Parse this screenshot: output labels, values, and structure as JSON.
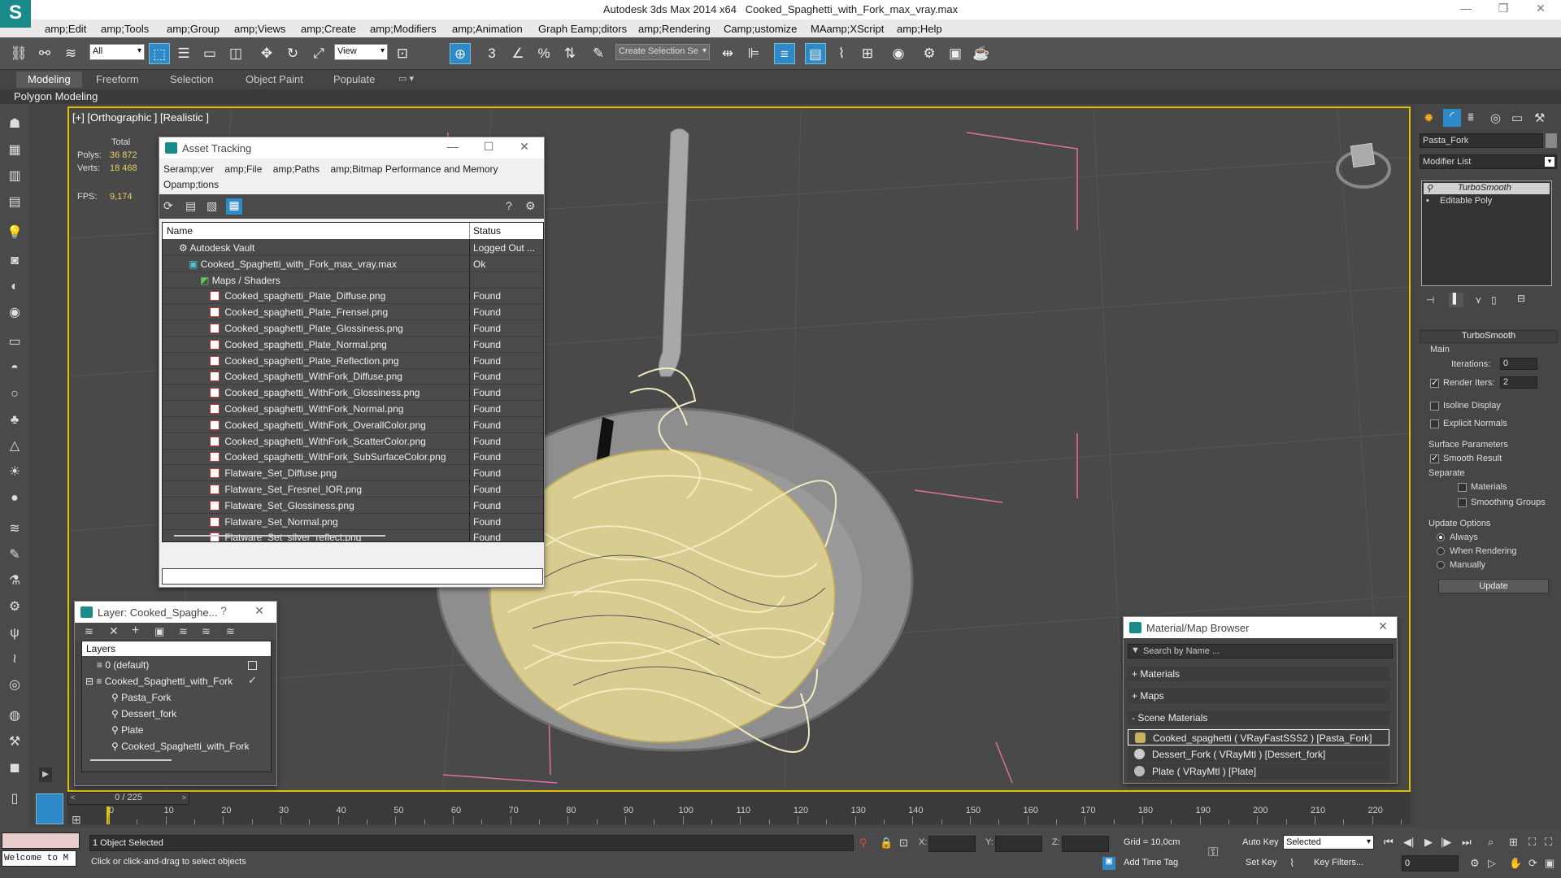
{
  "window": {
    "app_title": "Autodesk 3ds Max  2014 x64",
    "file_title": "Cooked_Spaghetti_with_Fork_max_vray.max"
  },
  "menu": [
    "amp;Edit",
    "amp;Tools",
    "amp;Group",
    "amp;Views",
    "amp;Create",
    "amp;Modifiers",
    "amp;Animation",
    "Graph Eamp;ditors",
    "amp;Rendering",
    "Camp;ustomize",
    "MAamp;XScript",
    "amp;Help"
  ],
  "toolbar": {
    "filter": "All",
    "coord": "View",
    "selection_set": "Create Selection Se",
    "snap_label": "3"
  },
  "ribbon": {
    "tabs": [
      "Modeling",
      "Freeform",
      "Selection",
      "Object Paint",
      "Populate"
    ],
    "sub": "Polygon Modeling"
  },
  "viewport": {
    "label": "[+] [Orthographic ] [Realistic ]",
    "stats": {
      "total_label": "Total",
      "polys_label": "Polys:",
      "polys": "36 872",
      "verts_label": "Verts:",
      "verts": "18 468",
      "fps_label": "FPS:",
      "fps": "9,174"
    }
  },
  "asset_tracking": {
    "title": "Asset Tracking",
    "menu": [
      "Seramp;ver",
      "amp;File",
      "amp;Paths",
      "amp;Bitmap Performance and Memory",
      "Opamp;tions"
    ],
    "col_name": "Name",
    "col_status": "Status",
    "rows": [
      {
        "name": "Autodesk Vault",
        "status": "Logged Out ..."
      },
      {
        "name": "Cooked_Spaghetti_with_Fork_max_vray.max",
        "status": "Ok"
      },
      {
        "name": "Maps / Shaders",
        "status": ""
      },
      {
        "name": "Cooked_spaghetti_Plate_Diffuse.png",
        "status": "Found"
      },
      {
        "name": "Cooked_spaghetti_Plate_Frensel.png",
        "status": "Found"
      },
      {
        "name": "Cooked_spaghetti_Plate_Glossiness.png",
        "status": "Found"
      },
      {
        "name": "Cooked_spaghetti_Plate_Normal.png",
        "status": "Found"
      },
      {
        "name": "Cooked_spaghetti_Plate_Reflection.png",
        "status": "Found"
      },
      {
        "name": "Cooked_spaghetti_WithFork_Diffuse.png",
        "status": "Found"
      },
      {
        "name": "Cooked_spaghetti_WithFork_Glossiness.png",
        "status": "Found"
      },
      {
        "name": "Cooked_spaghetti_WithFork_Normal.png",
        "status": "Found"
      },
      {
        "name": "Cooked_spaghetti_WithFork_OverallColor.png",
        "status": "Found"
      },
      {
        "name": "Cooked_spaghetti_WithFork_ScatterColor.png",
        "status": "Found"
      },
      {
        "name": "Cooked_spaghetti_WithFork_SubSurfaceColor.png",
        "status": "Found"
      },
      {
        "name": "Flatware_Set_Diffuse.png",
        "status": "Found"
      },
      {
        "name": "Flatware_Set_Fresnel_IOR.png",
        "status": "Found"
      },
      {
        "name": "Flatware_Set_Glossiness.png",
        "status": "Found"
      },
      {
        "name": "Flatware_Set_Normal.png",
        "status": "Found"
      },
      {
        "name": "Flatware_Set_silver_reflect.png",
        "status": "Found"
      }
    ]
  },
  "layer_panel": {
    "title": "Layer: Cooked_Spaghe...",
    "help": "?",
    "col": "Layers",
    "items": [
      "0 (default)",
      "Cooked_Spaghetti_with_Fork",
      "Pasta_Fork",
      "Dessert_fork",
      "Plate",
      "Cooked_Spaghetti_with_Fork"
    ]
  },
  "material_browser": {
    "title": "Material/Map Browser",
    "search_placeholder": "Search by Name ...",
    "sections": [
      "+ Materials",
      "+ Maps",
      "- Scene Materials"
    ],
    "items": [
      "Cooked_spaghetti ( VRayFastSSS2 ) [Pasta_Fork]",
      "Dessert_Fork ( VRayMtl ) [Dessert_fork]",
      "Plate ( VRayMtl ) [Plate]"
    ]
  },
  "command_panel": {
    "object_name": "Pasta_Fork",
    "modifier_list": "Modifier List",
    "stack": [
      "TurboSmooth",
      "Editable Poly"
    ],
    "rollout_title": "TurboSmooth",
    "main_label": "Main",
    "iterations_label": "Iterations:",
    "iterations": "0",
    "render_iters_label": "Render Iters:",
    "render_iters": "2",
    "isoline": "Isoline Display",
    "explicit": "Explicit Normals",
    "surface_params": "Surface Parameters",
    "smooth_result": "Smooth Result",
    "separate": "Separate",
    "materials": "Materials",
    "smoothing_groups": "Smoothing Groups",
    "update_options": "Update Options",
    "always": "Always",
    "when_rendering": "When Rendering",
    "manually": "Manually",
    "update_btn": "Update"
  },
  "timeline": {
    "frame": "0 / 225",
    "ticks": [
      "0",
      "10",
      "20",
      "30",
      "40",
      "50",
      "60",
      "70",
      "80",
      "90",
      "100",
      "110",
      "120",
      "130",
      "140",
      "150",
      "160",
      "170",
      "180",
      "190",
      "200",
      "210",
      "220"
    ]
  },
  "status": {
    "maxscript": "Welcome to M",
    "selected": "1 Object Selected",
    "prompt": "Click or click-and-drag to select objects",
    "x_label": "X:",
    "y_label": "Y:",
    "z_label": "Z:",
    "grid": "Grid = 10,0cm",
    "add_time_tag": "Add Time Tag",
    "auto_key": "Auto Key",
    "set_key": "Set Key",
    "key_mode": "Selected",
    "key_filters": "Key Filters...",
    "current_frame": "0"
  },
  "colors": {
    "accent": "#2d89c8",
    "viewport_border": "#e0c000",
    "spaghetti": "#e8dca0"
  }
}
